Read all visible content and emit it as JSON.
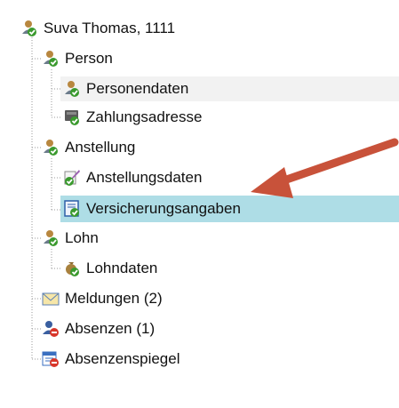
{
  "tree": {
    "root": {
      "label": "Suva Thomas, 1111",
      "icon": "person-check-icon"
    },
    "person": {
      "label": "Person",
      "icon": "person-check-icon"
    },
    "personendaten": {
      "label": "Personendaten",
      "icon": "person-check-icon"
    },
    "zahlungsadresse": {
      "label": "Zahlungsadresse",
      "icon": "payment-check-icon"
    },
    "anstellung": {
      "label": "Anstellung",
      "icon": "person-check-icon"
    },
    "anstellungsdaten": {
      "label": "Anstellungsdaten",
      "icon": "document-pen-check-icon"
    },
    "versicherungsangaben": {
      "label": "Versicherungsangaben",
      "icon": "form-check-icon",
      "selected": true
    },
    "lohn": {
      "label": "Lohn",
      "icon": "person-check-icon"
    },
    "lohndaten": {
      "label": "Lohndaten",
      "icon": "money-bag-check-icon"
    },
    "meldungen": {
      "label": "Meldungen (2)",
      "icon": "envelope-icon"
    },
    "absenzen": {
      "label": "Absenzen (1)",
      "icon": "person-red-icon"
    },
    "absenzenspiegel": {
      "label": "Absenzenspiegel",
      "icon": "calendar-red-icon"
    }
  },
  "colors": {
    "selection": "#aedde6",
    "arrow": "#c8523a",
    "check": "#3a9a2e"
  }
}
